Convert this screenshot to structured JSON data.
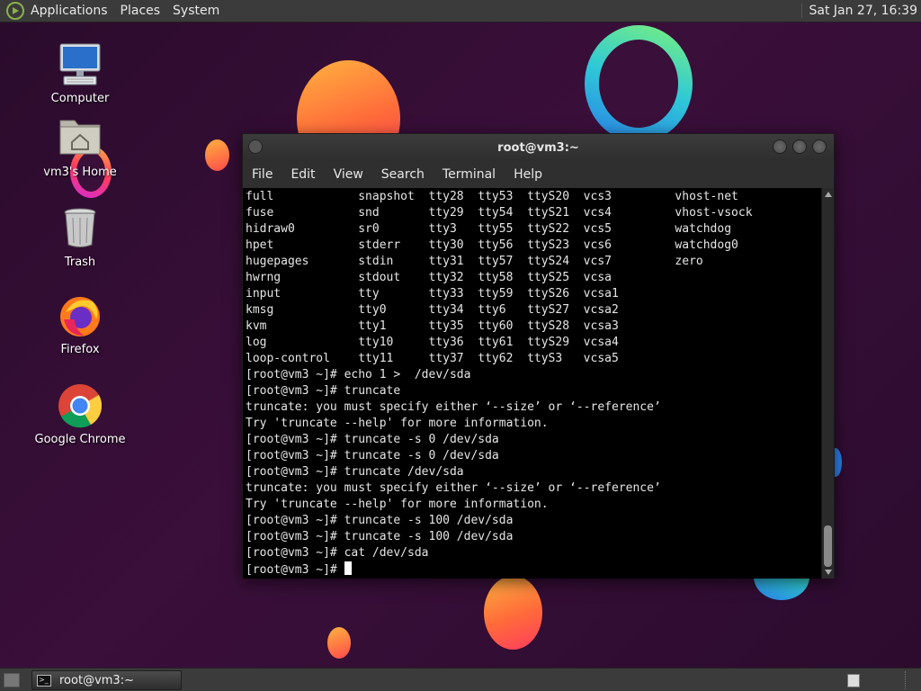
{
  "top_panel": {
    "menu": [
      "Applications",
      "Places",
      "System"
    ],
    "clock": "Sat Jan 27, 16:39"
  },
  "desktop_icons": [
    {
      "label": "Computer",
      "icon": "computer-icon"
    },
    {
      "label": "vm3's Home",
      "icon": "home-folder-icon"
    },
    {
      "label": "Trash",
      "icon": "trash-icon"
    },
    {
      "label": "Firefox",
      "icon": "firefox-icon"
    },
    {
      "label": "Google Chrome",
      "icon": "chrome-icon"
    }
  ],
  "terminal": {
    "title": "root@vm3:~",
    "menu": [
      "File",
      "Edit",
      "View",
      "Search",
      "Terminal",
      "Help"
    ],
    "lines": [
      "full            snapshot  tty28  tty53  ttyS20  vcs3         vhost-net",
      "fuse            snd       tty29  tty54  ttyS21  vcs4         vhost-vsock",
      "hidraw0         sr0       tty3   tty55  ttyS22  vcs5         watchdog",
      "hpet            stderr    tty30  tty56  ttyS23  vcs6         watchdog0",
      "hugepages       stdin     tty31  tty57  ttyS24  vcs7         zero",
      "hwrng           stdout    tty32  tty58  ttyS25  vcsa",
      "input           tty       tty33  tty59  ttyS26  vcsa1",
      "kmsg            tty0      tty34  tty6   ttyS27  vcsa2",
      "kvm             tty1      tty35  tty60  ttyS28  vcsa3",
      "log             tty10     tty36  tty61  ttyS29  vcsa4",
      "loop-control    tty11     tty37  tty62  ttyS3   vcsa5",
      "[root@vm3 ~]# echo 1 >  /dev/sda",
      "[root@vm3 ~]# truncate",
      "truncate: you must specify either ‘--size’ or ‘--reference’",
      "Try 'truncate --help' for more information.",
      "[root@vm3 ~]# truncate -s 0 /dev/sda",
      "[root@vm3 ~]# truncate -s 0 /dev/sda",
      "[root@vm3 ~]# truncate /dev/sda",
      "truncate: you must specify either ‘--size’ or ‘--reference’",
      "Try 'truncate --help' for more information.",
      "[root@vm3 ~]# truncate -s 100 /dev/sda",
      "[root@vm3 ~]# truncate -s 100 /dev/sda",
      "[root@vm3 ~]# cat /dev/sda"
    ],
    "prompt": "[root@vm3 ~]# "
  },
  "taskbar": {
    "task_label": "root@vm3:~",
    "task_icon_text": ">_"
  }
}
